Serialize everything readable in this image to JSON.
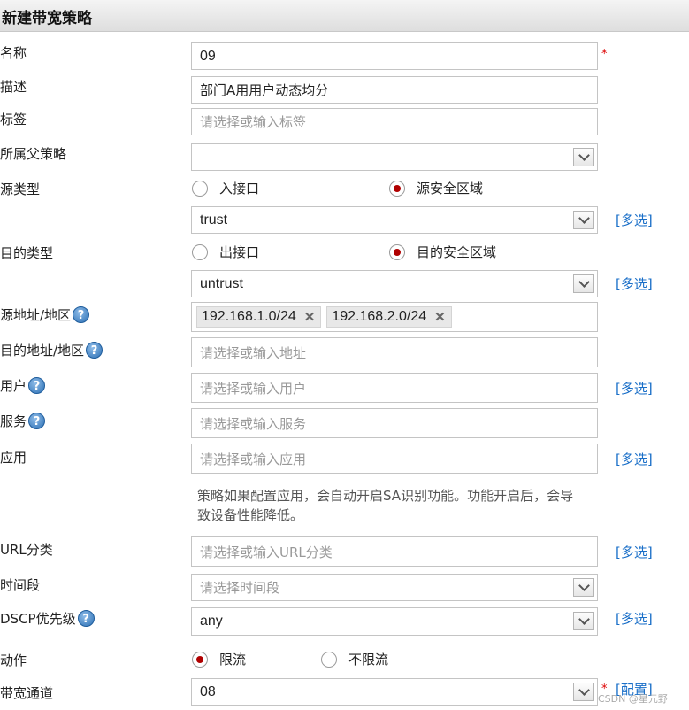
{
  "title": "新建带宽策略",
  "fields": {
    "name": {
      "label": "名称",
      "value": "09",
      "required": "*"
    },
    "desc": {
      "label": "描述",
      "value": "部门A用用户动态均分"
    },
    "tag": {
      "label": "标签",
      "placeholder": "请选择或输入标签"
    },
    "parent": {
      "label": "所属父策略",
      "value": ""
    },
    "src_type": {
      "label": "源类型",
      "opt1": "入接口",
      "opt2": "源安全区域",
      "selected": "源安全区域"
    },
    "src_zone": {
      "value": "trust",
      "multi": "[多选]"
    },
    "dst_type": {
      "label": "目的类型",
      "opt1": "出接口",
      "opt2": "目的安全区域",
      "selected": "目的安全区域"
    },
    "dst_zone": {
      "value": "untrust",
      "multi": "[多选]"
    },
    "src_addr": {
      "label": "源地址/地区",
      "chips": [
        "192.168.1.0/24",
        "192.168.2.0/24"
      ]
    },
    "dst_addr": {
      "label": "目的地址/地区",
      "placeholder": "请选择或输入地址"
    },
    "user": {
      "label": "用户",
      "placeholder": "请选择或输入用户",
      "multi": "[多选]"
    },
    "service": {
      "label": "服务",
      "placeholder": "请选择或输入服务"
    },
    "app": {
      "label": "应用",
      "placeholder": "请选择或输入应用",
      "multi": "[多选]",
      "note": "策略如果配置应用，会自动开启SA识别功能。功能开启后，会导致设备性能降低。"
    },
    "url": {
      "label": "URL分类",
      "placeholder": "请选择或输入URL分类",
      "multi": "[多选]"
    },
    "time": {
      "label": "时间段",
      "placeholder": "请选择时间段"
    },
    "dscp": {
      "label": "DSCP优先级",
      "value": "any",
      "multi": "[多选]"
    },
    "action": {
      "label": "动作",
      "opt1": "限流",
      "opt2": "不限流",
      "selected": "限流"
    },
    "channel": {
      "label": "带宽通道",
      "value": "08",
      "required": "*",
      "config": "[配置]"
    }
  },
  "help_glyph": "?",
  "watermark": "CSDN @星元野"
}
